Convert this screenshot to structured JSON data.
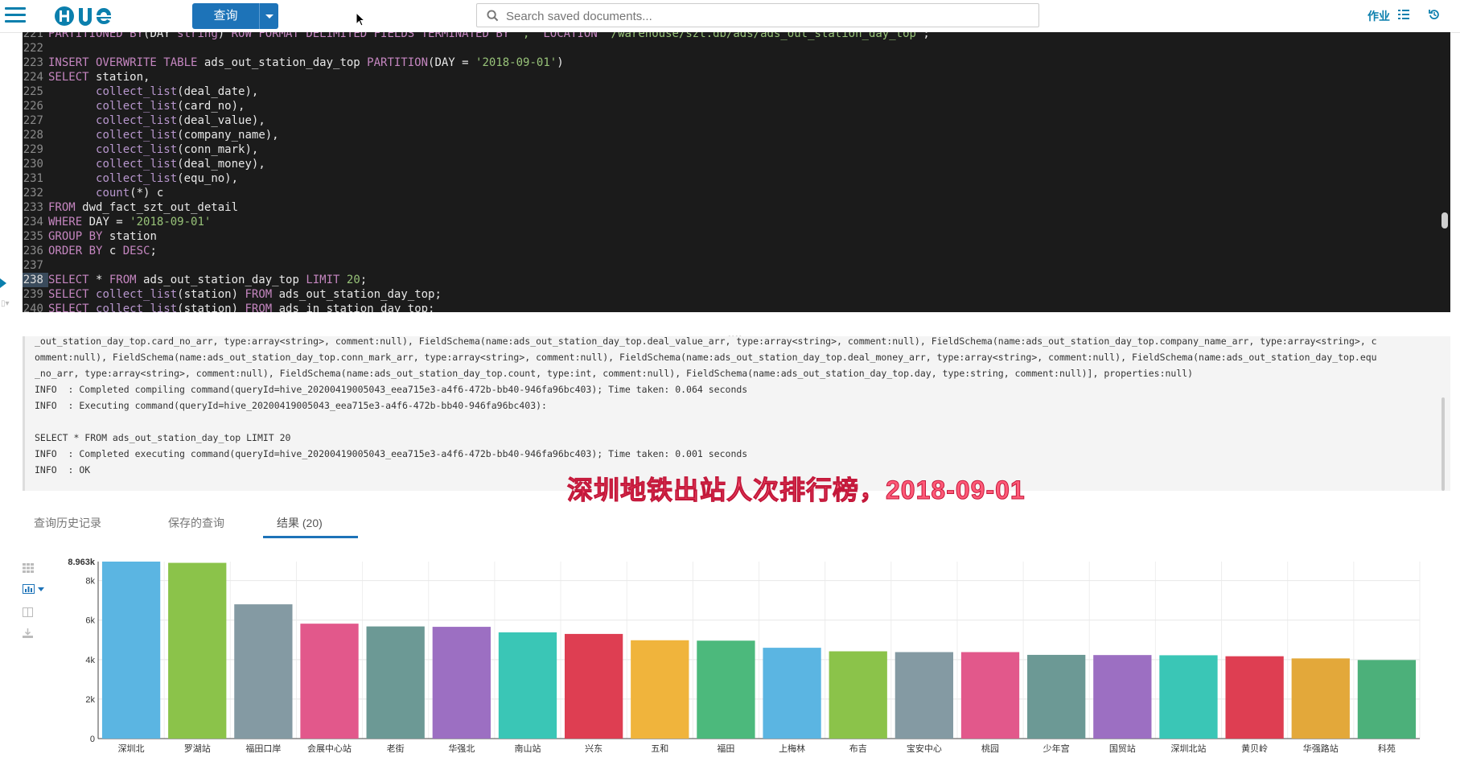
{
  "header": {
    "query_button": "查询",
    "search_placeholder": "Search saved documents...",
    "jobs_label": "作业"
  },
  "editor": {
    "lines": [
      {
        "n": "221",
        "segments": [
          [
            "kw",
            "PARTITIONED BY"
          ],
          [
            "code",
            "(DAY "
          ],
          [
            "kw",
            "string"
          ],
          [
            "code",
            ") "
          ],
          [
            "kw",
            "ROW FORMAT DELIMITED FIELDS TERMINATED BY"
          ],
          [
            "code",
            " "
          ],
          [
            "str",
            "','"
          ],
          [
            "code",
            " "
          ],
          [
            "kw",
            "LOCATION"
          ],
          [
            "code",
            " "
          ],
          [
            "str",
            "'/warehouse/szt.db/ads/ads_out_station_day_top'"
          ],
          [
            "code",
            ";"
          ]
        ]
      },
      {
        "n": "222",
        "segments": []
      },
      {
        "n": "223",
        "segments": [
          [
            "kw",
            "INSERT OVERWRITE TABLE"
          ],
          [
            "code",
            " ads_out_station_day_top "
          ],
          [
            "kw",
            "PARTITION"
          ],
          [
            "code",
            "(DAY = "
          ],
          [
            "str",
            "'2018-09-01'"
          ],
          [
            "code",
            ")"
          ]
        ]
      },
      {
        "n": "224",
        "segments": [
          [
            "kw",
            "SELECT"
          ],
          [
            "code",
            " station,"
          ]
        ]
      },
      {
        "n": "225",
        "segments": [
          [
            "code",
            "       "
          ],
          [
            "fn",
            "collect_list"
          ],
          [
            "code",
            "(deal_date),"
          ]
        ]
      },
      {
        "n": "226",
        "segments": [
          [
            "code",
            "       "
          ],
          [
            "fn",
            "collect_list"
          ],
          [
            "code",
            "(card_no),"
          ]
        ]
      },
      {
        "n": "227",
        "segments": [
          [
            "code",
            "       "
          ],
          [
            "fn",
            "collect_list"
          ],
          [
            "code",
            "(deal_value),"
          ]
        ]
      },
      {
        "n": "228",
        "segments": [
          [
            "code",
            "       "
          ],
          [
            "fn",
            "collect_list"
          ],
          [
            "code",
            "(company_name),"
          ]
        ]
      },
      {
        "n": "229",
        "segments": [
          [
            "code",
            "       "
          ],
          [
            "fn",
            "collect_list"
          ],
          [
            "code",
            "(conn_mark),"
          ]
        ]
      },
      {
        "n": "230",
        "segments": [
          [
            "code",
            "       "
          ],
          [
            "fn",
            "collect_list"
          ],
          [
            "code",
            "(deal_money),"
          ]
        ]
      },
      {
        "n": "231",
        "segments": [
          [
            "code",
            "       "
          ],
          [
            "fn",
            "collect_list"
          ],
          [
            "code",
            "(equ_no),"
          ]
        ]
      },
      {
        "n": "232",
        "segments": [
          [
            "code",
            "       "
          ],
          [
            "fn",
            "count"
          ],
          [
            "code",
            "(*) c"
          ]
        ]
      },
      {
        "n": "233",
        "segments": [
          [
            "kw",
            "FROM"
          ],
          [
            "code",
            " dwd_fact_szt_out_detail"
          ]
        ]
      },
      {
        "n": "234",
        "segments": [
          [
            "kw",
            "WHERE"
          ],
          [
            "code",
            " DAY = "
          ],
          [
            "str",
            "'2018-09-01'"
          ]
        ]
      },
      {
        "n": "235",
        "segments": [
          [
            "kw",
            "GROUP BY"
          ],
          [
            "code",
            " station"
          ]
        ]
      },
      {
        "n": "236",
        "segments": [
          [
            "kw",
            "ORDER BY"
          ],
          [
            "code",
            " c "
          ],
          [
            "kw",
            "DESC"
          ],
          [
            "code",
            ";"
          ]
        ]
      },
      {
        "n": "237",
        "segments": []
      },
      {
        "n": "238",
        "active": true,
        "segments": [
          [
            "kw",
            "SELECT"
          ],
          [
            "code",
            " * "
          ],
          [
            "kw",
            "FROM"
          ],
          [
            "code",
            " ads_out_station_day_top "
          ],
          [
            "kw",
            "LIMIT"
          ],
          [
            "code",
            " "
          ],
          [
            "str",
            "20"
          ],
          [
            "code",
            ";"
          ]
        ]
      },
      {
        "n": "239",
        "segments": [
          [
            "kw",
            "SELECT"
          ],
          [
            "code",
            " "
          ],
          [
            "fn",
            "collect_list"
          ],
          [
            "code",
            "(station) "
          ],
          [
            "kw",
            "FROM"
          ],
          [
            "code",
            " ads_out_station_day_top;"
          ]
        ]
      },
      {
        "n": "240",
        "segments": [
          [
            "kw",
            "SELECT"
          ],
          [
            "code",
            " "
          ],
          [
            "fn",
            "collect_list"
          ],
          [
            "code",
            "(station) "
          ],
          [
            "kw",
            "FROM"
          ],
          [
            "code",
            " ads_in_station_day_top;"
          ]
        ]
      }
    ]
  },
  "log": {
    "lines": [
      "_out_station_day_top.card_no_arr, type:array<string>, comment:null), FieldSchema(name:ads_out_station_day_top.deal_value_arr, type:array<string>, comment:null), FieldSchema(name:ads_out_station_day_top.company_name_arr, type:array<string>, c",
      "omment:null), FieldSchema(name:ads_out_station_day_top.conn_mark_arr, type:array<string>, comment:null), FieldSchema(name:ads_out_station_day_top.deal_money_arr, type:array<string>, comment:null), FieldSchema(name:ads_out_station_day_top.equ",
      "_no_arr, type:array<string>, comment:null), FieldSchema(name:ads_out_station_day_top.count, type:int, comment:null), FieldSchema(name:ads_out_station_day_top.day, type:string, comment:null)], properties:null)",
      "INFO  : Completed compiling command(queryId=hive_20200419005043_eea715e3-a4f6-472b-bb40-946fa96bc403); Time taken: 0.064 seconds",
      "INFO  : Executing command(queryId=hive_20200419005043_eea715e3-a4f6-472b-bb40-946fa96bc403):",
      "",
      "SELECT * FROM ads_out_station_day_top LIMIT 20",
      "INFO  : Completed executing command(queryId=hive_20200419005043_eea715e3-a4f6-472b-bb40-946fa96bc403); Time taken: 0.001 seconds",
      "INFO  : OK"
    ]
  },
  "caption": "深圳地铁出站人次排行榜，2018-09-01",
  "tabs": [
    {
      "label": "查询历史记录"
    },
    {
      "label": "保存的查询"
    },
    {
      "label": "结果 (20)"
    }
  ],
  "chart_data": {
    "type": "bar",
    "categories": [
      "深圳北",
      "罗湖站",
      "福田口岸",
      "会展中心站",
      "老街",
      "华强北",
      "南山站",
      "兴东",
      "五和",
      "福田",
      "上梅林",
      "布吉",
      "宝安中心",
      "桃园",
      "少年宫",
      "国贸站",
      "深圳北站",
      "黄贝岭",
      "华强路站",
      "科苑"
    ],
    "values": [
      8963,
      8900,
      6800,
      5820,
      5680,
      5660,
      5380,
      5300,
      4980,
      4960,
      4600,
      4420,
      4380,
      4380,
      4240,
      4230,
      4220,
      4170,
      4060,
      3980
    ],
    "y_ticks": [
      "0",
      "2k",
      "4k",
      "6k",
      "8k"
    ],
    "y_max_label": "8.963k",
    "ylim": [
      0,
      8963
    ],
    "grid": true,
    "colors": [
      "#5BB5E2",
      "#8BC34A",
      "#849AA3",
      "#E2588B",
      "#6C9995",
      "#9C6FC2",
      "#3AC6B6",
      "#DE3E52",
      "#F0B43C",
      "#4CB97C",
      "#5BB5E2",
      "#8BC34A",
      "#849AA3",
      "#E2588B",
      "#6C9995",
      "#9C6FC2",
      "#3AC6B6",
      "#DE3E52",
      "#E3A83A",
      "#4CB07A"
    ]
  }
}
